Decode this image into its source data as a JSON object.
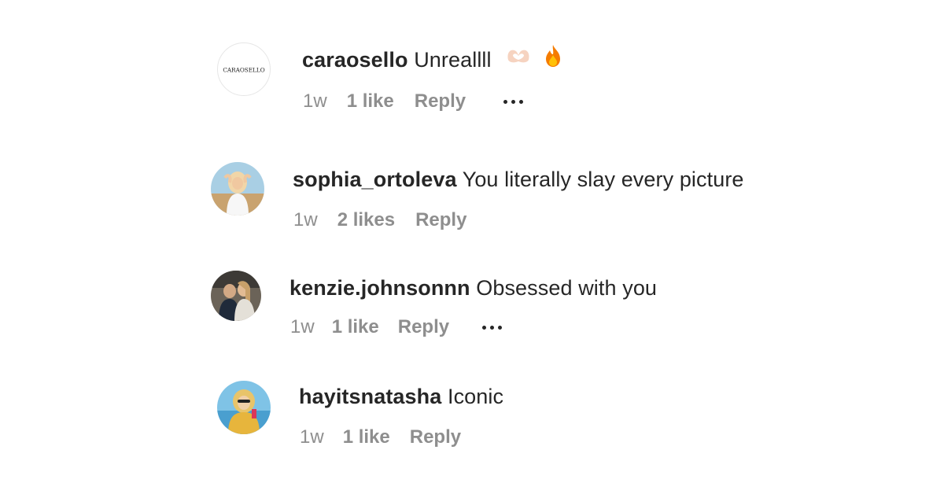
{
  "comments": [
    {
      "username": "caraosello",
      "text": "Unreallll",
      "emojis": [
        "heart-hands-icon",
        "fire-icon"
      ],
      "time": "1w",
      "likes": "1 like",
      "reply": "Reply",
      "avatar_text": "CARAOSELLO",
      "has_more": true
    },
    {
      "username": "sophia_ortoleva",
      "text": "You literally slay every picture",
      "time": "1w",
      "likes": "2 likes",
      "reply": "Reply",
      "has_more": false
    },
    {
      "username": "kenzie.johnsonnn",
      "text": "Obsessed with you",
      "time": "1w",
      "likes": "1 like",
      "reply": "Reply",
      "has_more": true
    },
    {
      "username": "hayitsnatasha",
      "text": "Iconic",
      "time": "1w",
      "likes": "1 like",
      "reply": "Reply",
      "has_more": false
    }
  ],
  "colors": {
    "text": "#262626",
    "secondary": "#8e8e8e"
  }
}
